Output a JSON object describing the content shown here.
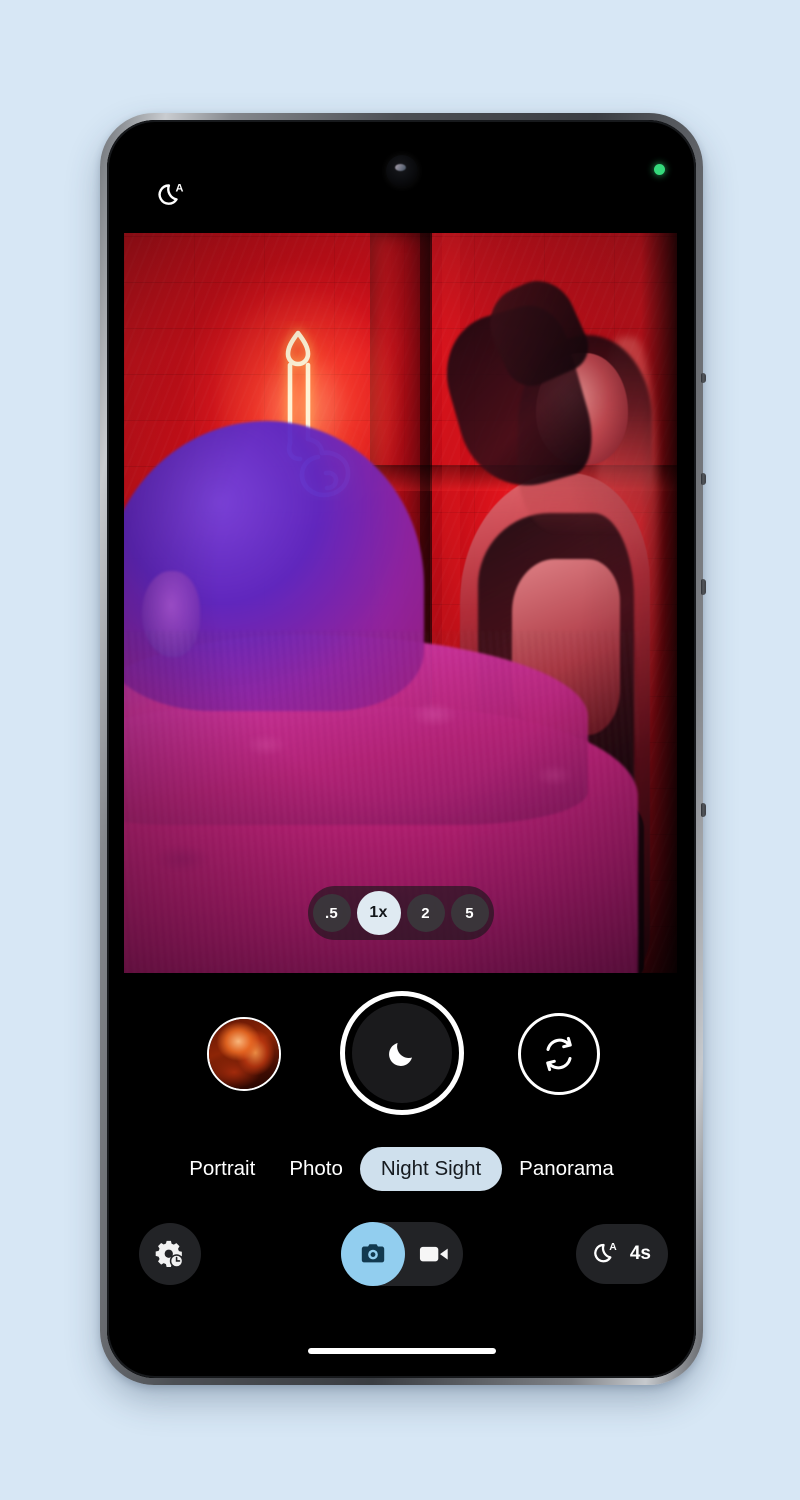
{
  "background_color": "#d7e7f5",
  "device": {
    "name": "android-smartphone",
    "frame_color": "#6f7378",
    "screen_background": "#000000"
  },
  "status_bar": {
    "nightsight_auto_icon": "moon-auto-icon",
    "front_camera_icon": "punch-hole-camera-icon",
    "privacy_indicator_icon": "green-privacy-dot-icon",
    "privacy_indicator_color": "#35d97b"
  },
  "viewfinder": {
    "scene_description": "Two people posing in a red neon-lit alcove at night; a neon candle sign glows on the brick wall",
    "neon_sign_icon": "neon-candle-sign",
    "zoom_bar": {
      "options": [
        {
          "label": ".5",
          "selected": false
        },
        {
          "label": "1x",
          "selected": true
        },
        {
          "label": "2",
          "selected": false
        },
        {
          "label": "5",
          "selected": false
        }
      ]
    }
  },
  "controls": {
    "gallery_thumbnail_icon": "gallery-thumbnail",
    "shutter_icon": "moon-icon",
    "flip_camera_icon": "camera-flip-icon"
  },
  "mode_bar": {
    "modes": [
      {
        "label": "Portrait",
        "selected": false
      },
      {
        "label": "Photo",
        "selected": false
      },
      {
        "label": "Night Sight",
        "selected": true
      },
      {
        "label": "Panorama",
        "selected": false
      }
    ],
    "active_color": "#cfe0ed"
  },
  "tool_bar": {
    "settings_icon": "gear-timer-icon",
    "capture_toggle": {
      "photo_icon": "camera-icon",
      "photo_selected": true,
      "photo_active_color": "#92ceef",
      "video_icon": "video-camera-icon",
      "video_selected": false
    },
    "nightsight": {
      "icon": "moon-auto-icon",
      "duration": "4s"
    }
  },
  "system": {
    "home_indicator": "home-indicator-bar"
  }
}
